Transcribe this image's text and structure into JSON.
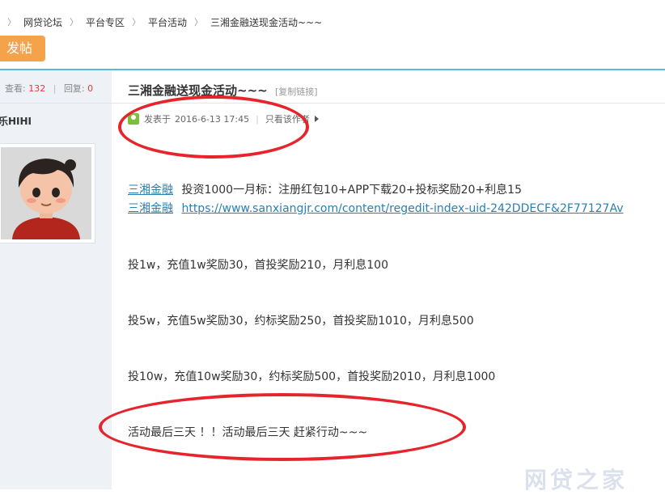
{
  "breadcrumb": {
    "items": [
      "网贷论坛",
      "平台专区",
      "平台活动",
      "三湘金融送现金活动~~~"
    ],
    "separator": "〉"
  },
  "post_button": {
    "label": "发帖"
  },
  "sidebar": {
    "views_label": "查看:",
    "views_count": "132",
    "replies_label": "回复:",
    "replies_count": "0",
    "username": "乐HIHI"
  },
  "post": {
    "title": "三湘金融送现金活动~~~",
    "copy_link": "[复制链接]",
    "posted_label": "发表于",
    "posted_time": "2016-6-13 17:45",
    "author_only": "只看该作者",
    "lines": [
      {
        "prefix": "三湘金融",
        "text": "投资1000一月标：注册红包10+APP下载20+投标奖励20+利息15"
      },
      {
        "prefix": "三湘金融",
        "text": "https://www.sanxiangjr.com/content/regedit-index-uid-242DDECF&2F77127Av"
      },
      {
        "text": "投1w，充值1w奖励30，首投奖励210，月利息100"
      },
      {
        "text": "投5w，充值5w奖励30，约标奖励250，首投奖励1010，月利息500"
      },
      {
        "text": "投10w，充值10w奖励30，约标奖励500，首投奖励2010，月利息1000"
      },
      {
        "text": "活动最后三天 ！！活动最后三天 赶紧行动~~~"
      }
    ]
  },
  "watermark": "网贷之家",
  "colors": {
    "accent_line": "#5bb8d6",
    "post_button": "#f5a34a",
    "annotation": "#e5252b",
    "link": "#2a7fb0",
    "sidebar_bg": "#eef1f6"
  }
}
